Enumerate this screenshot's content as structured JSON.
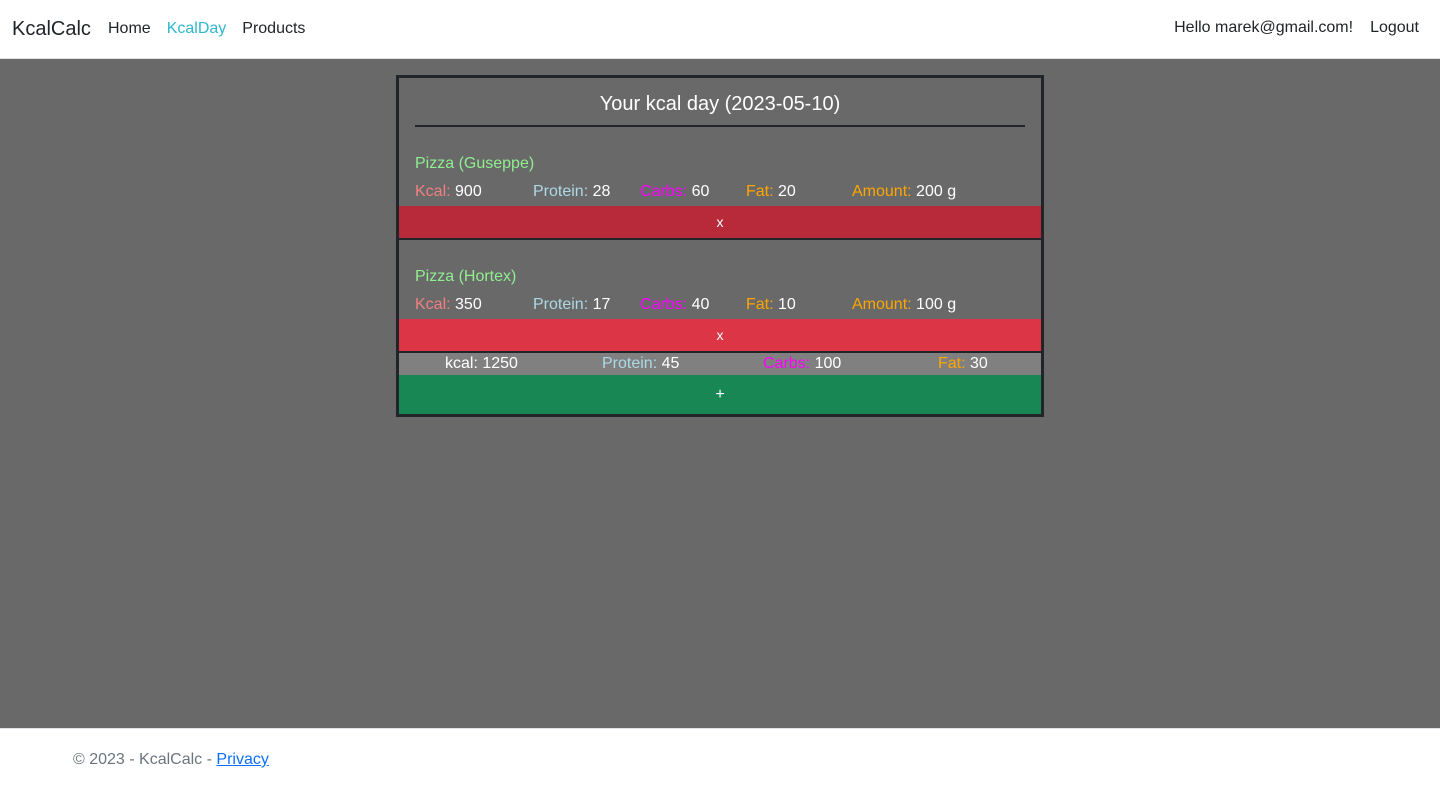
{
  "navbar": {
    "brand": "KcalCalc",
    "links": [
      {
        "label": "Home"
      },
      {
        "label": "KcalDay"
      },
      {
        "label": "Products"
      }
    ],
    "greeting": "Hello marek@gmail.com!",
    "logout": "Logout"
  },
  "day": {
    "title": "Your kcal day (2023-05-10)",
    "labels": {
      "kcal": "Kcal:",
      "protein": "Protein:",
      "carbs": "Carbs:",
      "fat": "Fat:",
      "amount": "Amount:"
    },
    "entries": [
      {
        "name": "Pizza (Guseppe)",
        "kcal": "900",
        "protein": "28",
        "carbs": "60",
        "fat": "20",
        "amount": "200 g",
        "delete_label": "x"
      },
      {
        "name": "Pizza (Hortex)",
        "kcal": "350",
        "protein": "17",
        "carbs": "40",
        "fat": "10",
        "amount": "100 g",
        "delete_label": "x"
      }
    ],
    "totals": {
      "kcal_label": "kcal:",
      "kcal": "1250",
      "protein_label": "Protein:",
      "protein": "45",
      "carbs_label": "Carbs:",
      "carbs": "100",
      "fat_label": "Fat:",
      "fat": "30"
    },
    "add_label": "+"
  },
  "footer": {
    "copyright": "© 2023 - KcalCalc - ",
    "privacy_link": "Privacy"
  },
  "colors": {
    "background": "#696969",
    "kcal": "#f08080",
    "protein": "#add8e6",
    "carbs": "#ff00ff",
    "fat": "#ffa500",
    "product_name": "#90ee90",
    "delete": "#dc3545",
    "add": "#198754",
    "active_nav": "#2eb7ce"
  }
}
